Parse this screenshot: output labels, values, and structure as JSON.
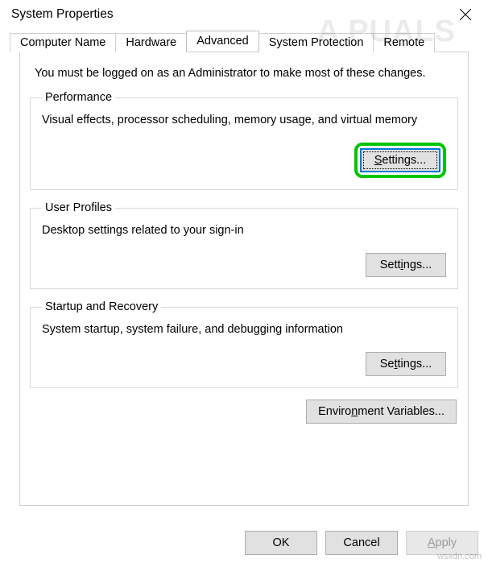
{
  "window": {
    "title": "System Properties"
  },
  "tabs": [
    "Computer Name",
    "Hardware",
    "Advanced",
    "System Protection",
    "Remote"
  ],
  "advanced": {
    "notice": "You must be logged on as an Administrator to make most of these changes.",
    "performance": {
      "title": "Performance",
      "desc": "Visual effects, processor scheduling, memory usage, and virtual memory",
      "button_ak": "S",
      "button_rest": "ettings..."
    },
    "user_profiles": {
      "title": "User Profiles",
      "desc": "Desktop settings related to your sign-in",
      "button_pre": "Sett",
      "button_ak": "i",
      "button_post": "ngs..."
    },
    "startup": {
      "title": "Startup and Recovery",
      "desc": "System startup, system failure, and debugging information",
      "button_pre": "Se",
      "button_ak": "t",
      "button_post": "tings..."
    },
    "env": {
      "button_pre": "Enviro",
      "button_ak": "n",
      "button_post": "ment Variables..."
    }
  },
  "footer": {
    "ok": "OK",
    "cancel": "Cancel",
    "apply_ak": "A",
    "apply_rest": "pply"
  },
  "watermark": {
    "brand": "A PUALS",
    "source": "wsxdn.com"
  }
}
